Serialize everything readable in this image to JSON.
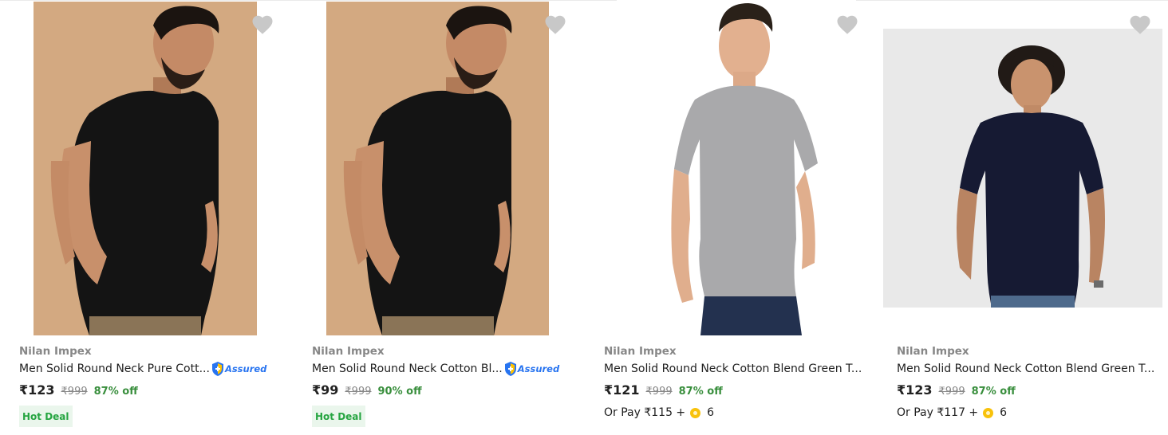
{
  "colors": {
    "discount_green": "#388e3c",
    "hot_deal_bg": "#eaf6ec",
    "assured_blue": "#2874f0",
    "heart_gray": "#c8c8c8"
  },
  "products": [
    {
      "brand": "Nilan Impex",
      "title": "Men Solid Round Neck Cotton Bl...",
      "assured": true,
      "assured_label": "Assured",
      "price": "₹99",
      "mrp": "₹999",
      "discount": "90% off",
      "hot_deal_label": "Hot Deal",
      "image": "black-tshirt-model-image",
      "wishlist_icon": "heart-icon"
    },
    {
      "brand": "Nilan Impex",
      "title": "Men Solid Round Neck Cotton Blend Green T...",
      "assured": false,
      "price": "₹121",
      "mrp": "₹999",
      "discount": "87% off",
      "or_pay_text": "Or Pay ₹115 +",
      "coins": "6",
      "image": "grey-tshirt-model-image",
      "wishlist_icon": "heart-icon"
    },
    {
      "brand": "Nilan Impex",
      "title": "Men Solid Round Neck Cotton Blend Green T...",
      "assured": false,
      "price": "₹123",
      "mrp": "₹999",
      "discount": "87% off",
      "or_pay_text": "Or Pay ₹117 +",
      "coins": "6",
      "image": "navy-tshirt-model-image",
      "wishlist_icon": "heart-icon"
    },
    {
      "brand": "Nilan Impex",
      "title": "Men Solid Round Neck Pure Cott...",
      "assured": true,
      "assured_label": "Assured",
      "price": "₹123",
      "mrp": "₹999",
      "discount": "87% off",
      "hot_deal_label": "Hot Deal",
      "image": "black-tshirt-model-image",
      "wishlist_icon": "heart-icon"
    }
  ]
}
